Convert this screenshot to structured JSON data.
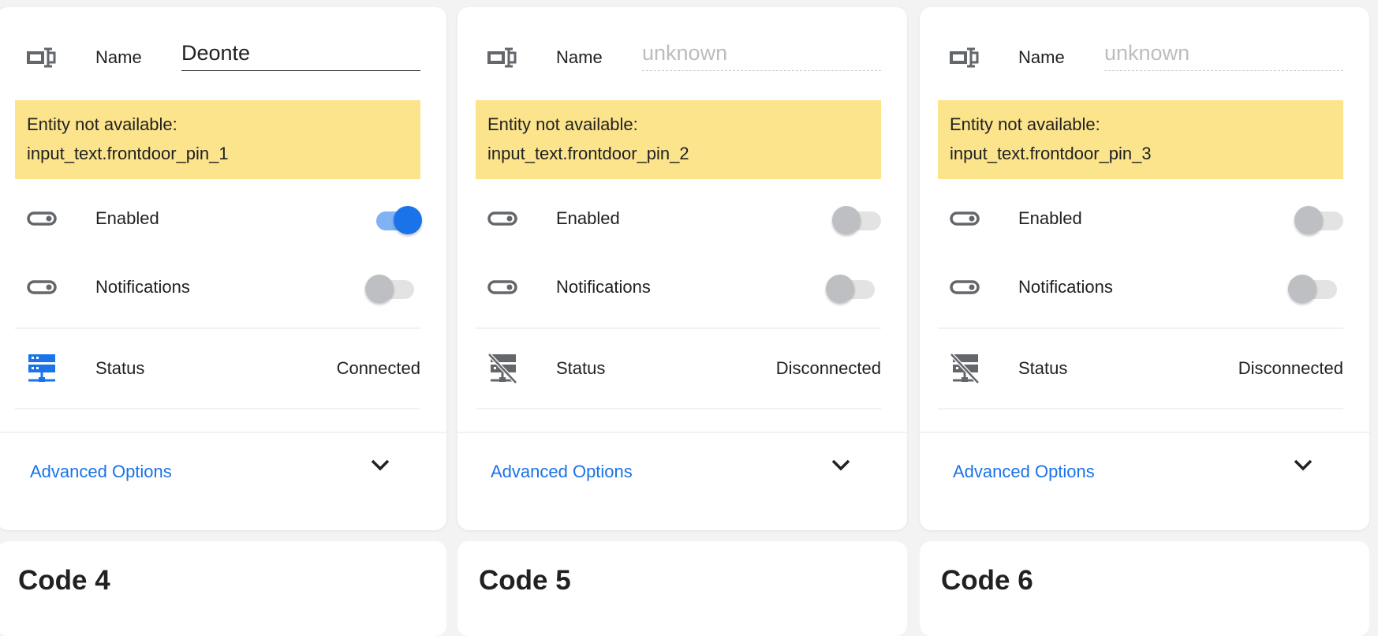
{
  "cards": [
    {
      "name_label": "Name",
      "name_value": "Deonte",
      "name_placeholder": "",
      "warning_line1": "Entity not available:",
      "warning_line2": "input_text.frontdoor_pin_1",
      "enabled_label": "Enabled",
      "enabled": true,
      "notifications_label": "Notifications",
      "notifications": false,
      "status_label": "Status",
      "status_value": "Connected",
      "advanced": "Advanced Options"
    },
    {
      "name_label": "Name",
      "name_value": "",
      "name_placeholder": "unknown",
      "warning_line1": "Entity not available:",
      "warning_line2": "input_text.frontdoor_pin_2",
      "enabled_label": "Enabled",
      "enabled": false,
      "notifications_label": "Notifications",
      "notifications": false,
      "status_label": "Status",
      "status_value": "Disconnected",
      "advanced": "Advanced Options"
    },
    {
      "name_label": "Name",
      "name_value": "",
      "name_placeholder": "unknown",
      "warning_line1": "Entity not available:",
      "warning_line2": "input_text.frontdoor_pin_3",
      "enabled_label": "Enabled",
      "enabled": false,
      "notifications_label": "Notifications",
      "notifications": false,
      "status_label": "Status",
      "status_value": "Disconnected",
      "advanced": "Advanced Options"
    }
  ],
  "code_cards": [
    "Code 4",
    "Code 5",
    "Code 6"
  ],
  "colors": {
    "accent": "#1a73e8",
    "warning": "#fbe48c",
    "icon": "#63666b"
  }
}
